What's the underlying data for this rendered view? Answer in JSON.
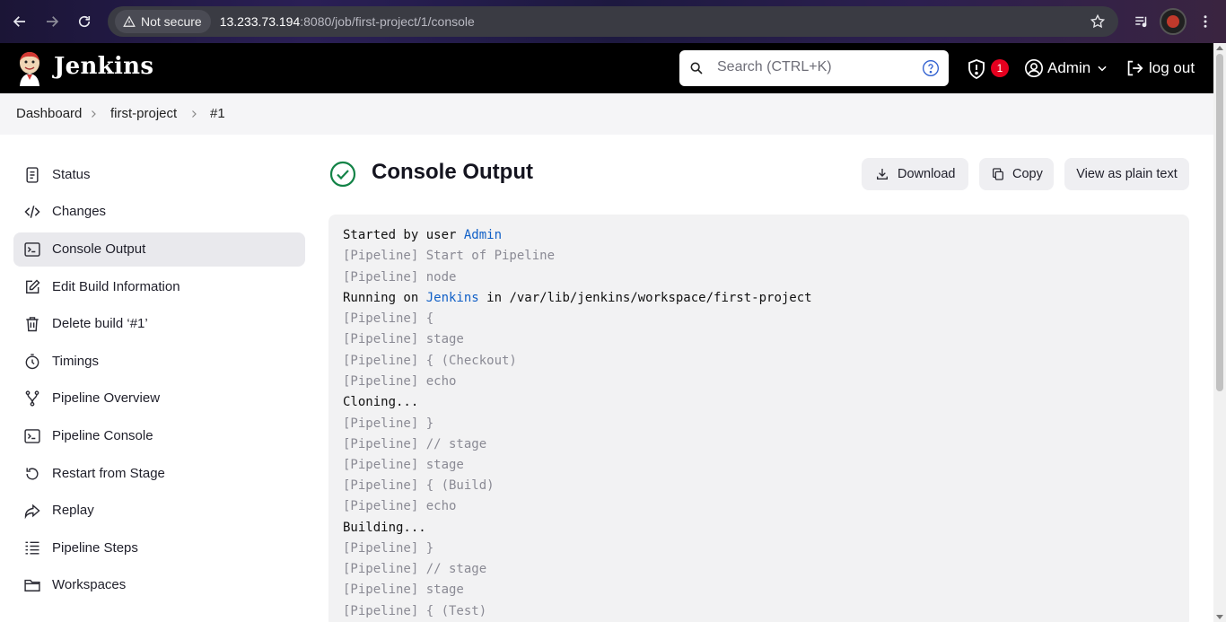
{
  "browser": {
    "security_label": "Not secure",
    "url_host": "13.233.73.194",
    "url_path": ":8080/job/first-project/1/console",
    "icons": [
      "back-icon",
      "forward-icon",
      "reload-icon",
      "warning-icon",
      "star-icon",
      "media-icon",
      "profile-avatar",
      "more-icon"
    ]
  },
  "header": {
    "title": "Jenkins",
    "search_placeholder": "Search (CTRL+K)",
    "notification_count": "1",
    "user_name": "Admin",
    "logout_label": "log out"
  },
  "breadcrumb": {
    "items": [
      "Dashboard",
      "first-project",
      "#1"
    ]
  },
  "sidebar": {
    "items": [
      {
        "label": "Status",
        "icon": "status-icon"
      },
      {
        "label": "Changes",
        "icon": "code-icon"
      },
      {
        "label": "Console Output",
        "icon": "terminal-icon",
        "active": true
      },
      {
        "label": "Edit Build Information",
        "icon": "edit-icon"
      },
      {
        "label": "Delete build ‘#1’",
        "icon": "trash-icon"
      },
      {
        "label": "Timings",
        "icon": "stopwatch-icon"
      },
      {
        "label": "Pipeline Overview",
        "icon": "branch-icon"
      },
      {
        "label": "Pipeline Console",
        "icon": "terminal-icon"
      },
      {
        "label": "Restart from Stage",
        "icon": "restart-icon"
      },
      {
        "label": "Replay",
        "icon": "replay-icon"
      },
      {
        "label": "Pipeline Steps",
        "icon": "list-icon"
      },
      {
        "label": "Workspaces",
        "icon": "folder-icon"
      }
    ]
  },
  "main": {
    "title": "Console Output",
    "status_color": "#138347",
    "buttons": {
      "download": "Download",
      "copy": "Copy",
      "plain_text": "View as plain text"
    }
  },
  "console": {
    "lines": [
      {
        "text": "Started by user ",
        "link": "Admin",
        "kind": "normal"
      },
      {
        "text": "[Pipeline] Start of Pipeline",
        "kind": "pipeline"
      },
      {
        "text": "[Pipeline] node",
        "kind": "pipeline"
      },
      {
        "text": "Running on ",
        "link": "Jenkins",
        "after": " in /var/lib/jenkins/workspace/first-project",
        "kind": "normal"
      },
      {
        "text": "[Pipeline] {",
        "kind": "pipeline"
      },
      {
        "text": "[Pipeline] stage",
        "kind": "pipeline"
      },
      {
        "text": "[Pipeline] { (Checkout)",
        "kind": "pipeline"
      },
      {
        "text": "[Pipeline] echo",
        "kind": "pipeline"
      },
      {
        "text": "Cloning...",
        "kind": "normal"
      },
      {
        "text": "[Pipeline] }",
        "kind": "pipeline"
      },
      {
        "text": "[Pipeline] // stage",
        "kind": "pipeline"
      },
      {
        "text": "[Pipeline] stage",
        "kind": "pipeline"
      },
      {
        "text": "[Pipeline] { (Build)",
        "kind": "pipeline"
      },
      {
        "text": "[Pipeline] echo",
        "kind": "pipeline"
      },
      {
        "text": "Building...",
        "kind": "normal"
      },
      {
        "text": "[Pipeline] }",
        "kind": "pipeline"
      },
      {
        "text": "[Pipeline] // stage",
        "kind": "pipeline"
      },
      {
        "text": "[Pipeline] stage",
        "kind": "pipeline"
      },
      {
        "text": "[Pipeline] { (Test)",
        "kind": "pipeline"
      }
    ]
  }
}
